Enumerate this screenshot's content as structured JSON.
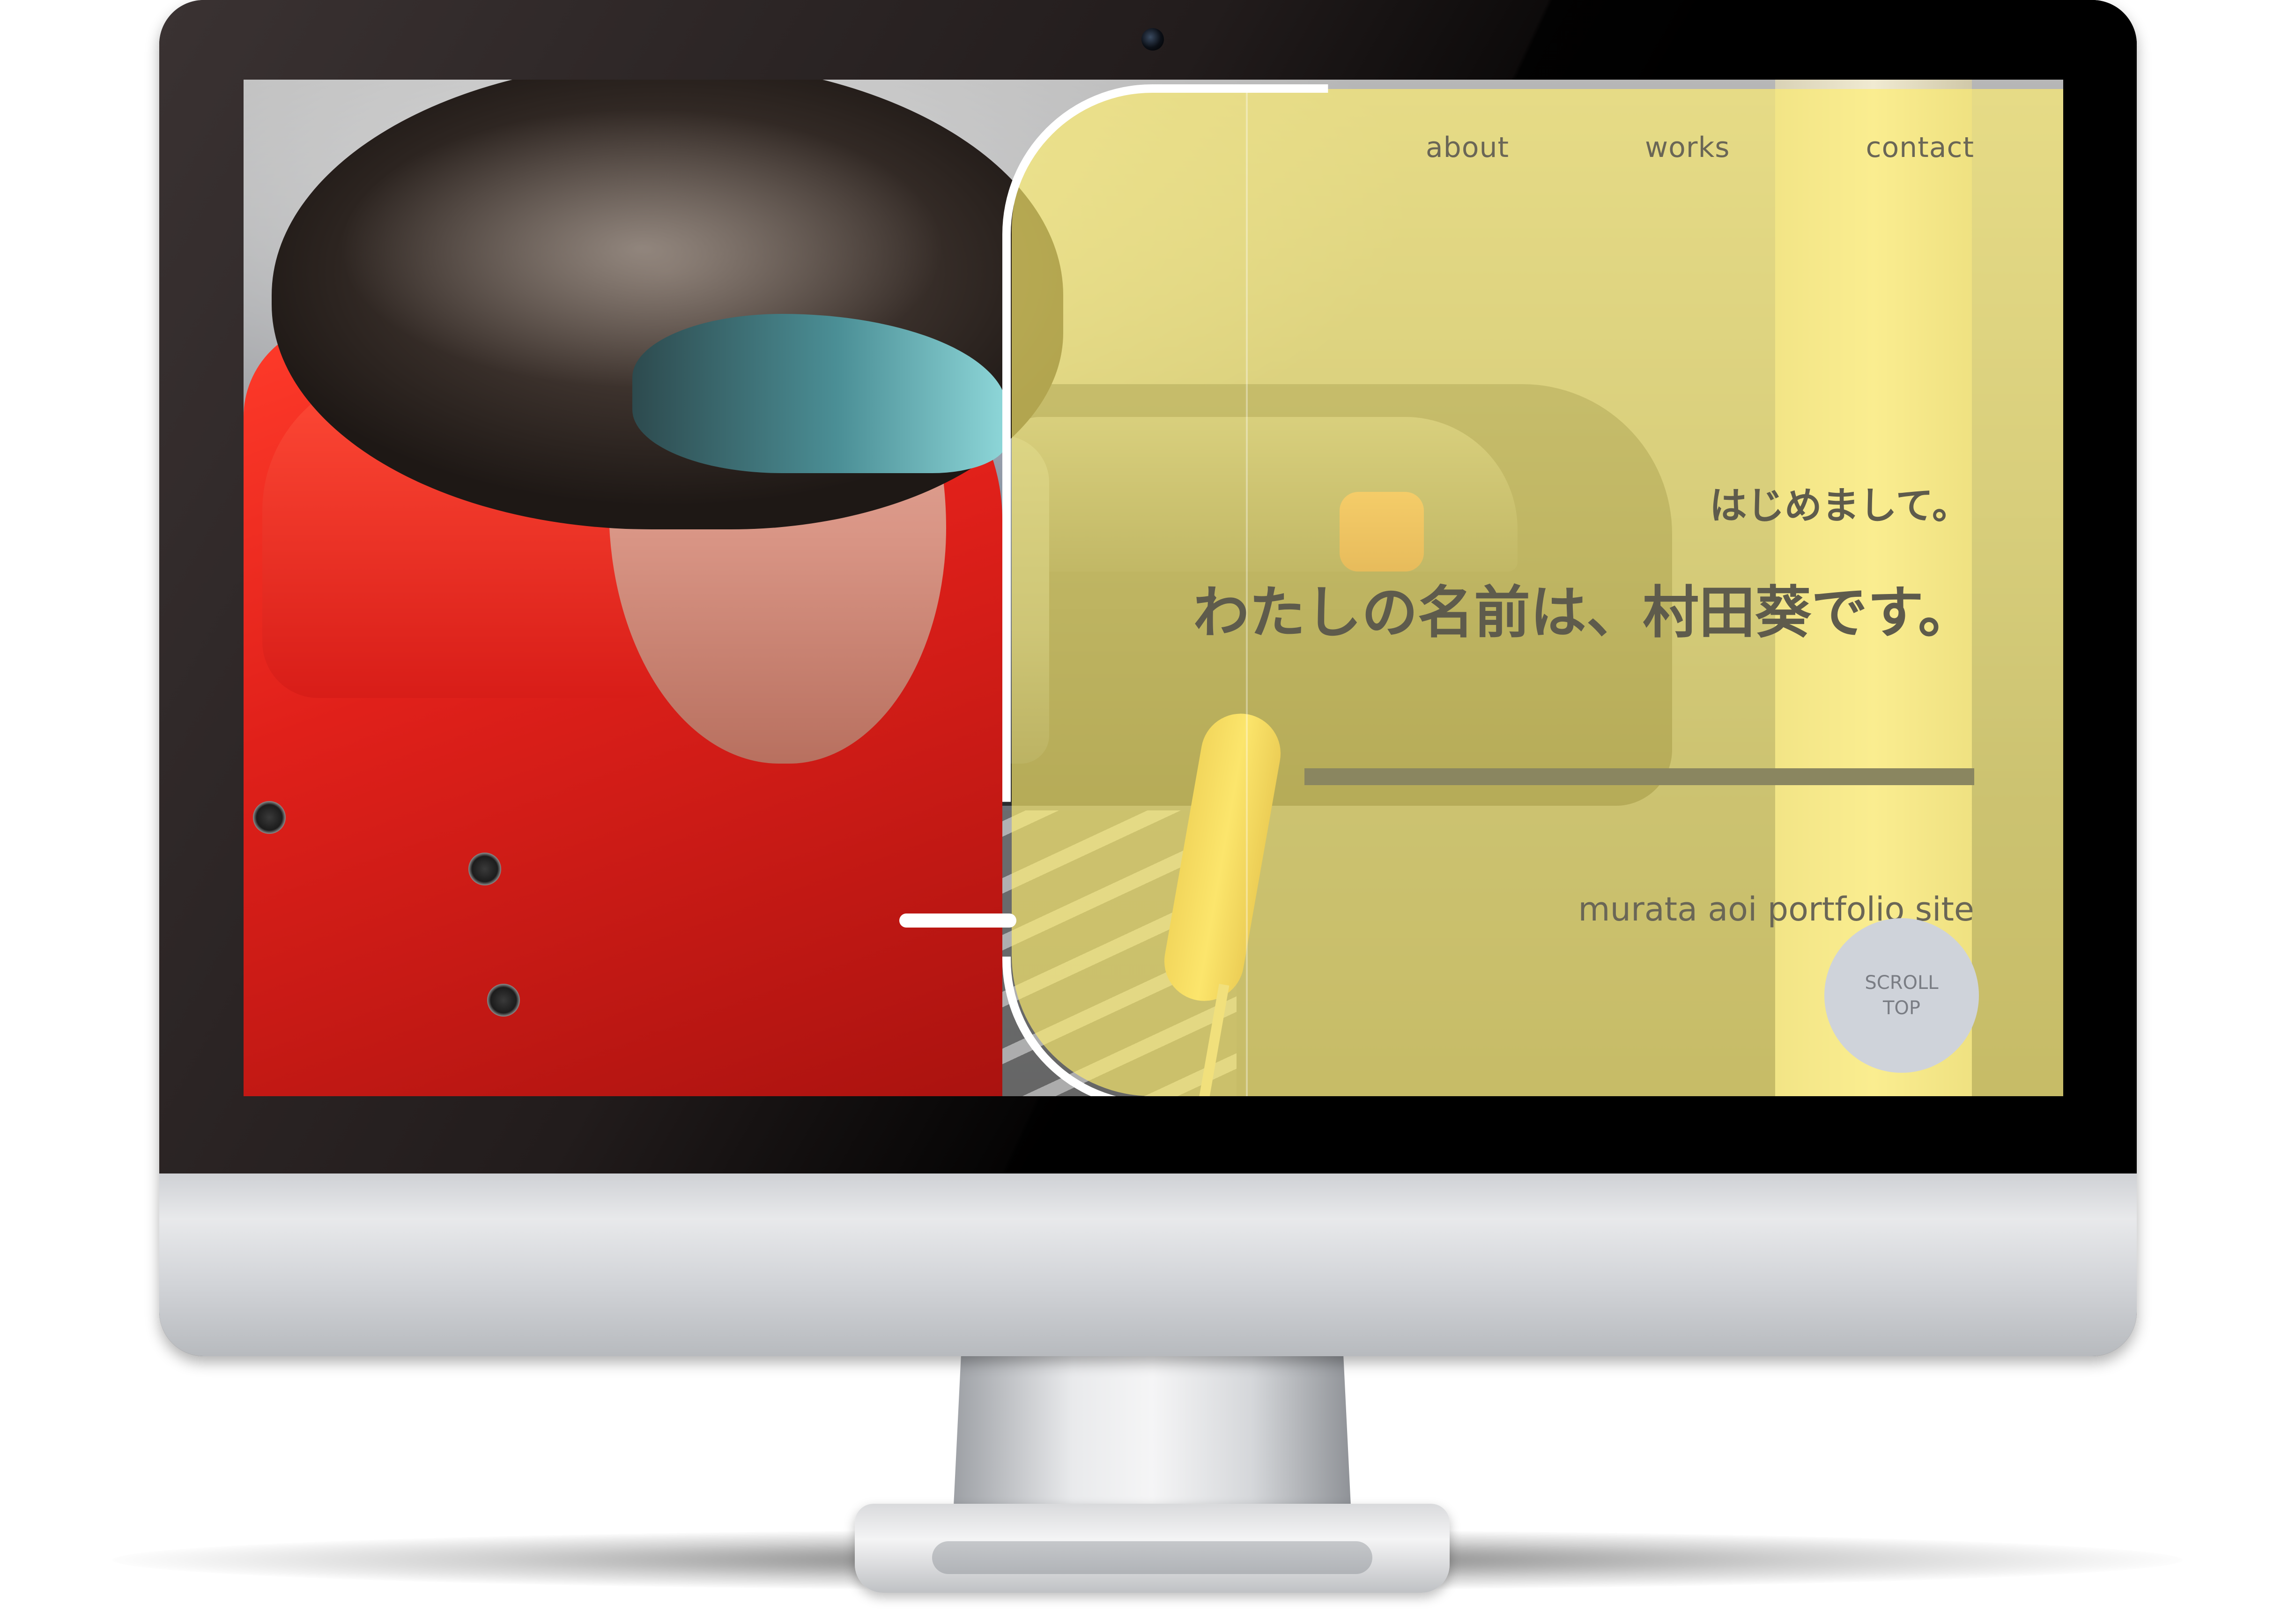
{
  "nav": {
    "items": [
      {
        "label": "about"
      },
      {
        "label": "works"
      },
      {
        "label": "contact"
      }
    ]
  },
  "hero": {
    "greeting_small": "はじめまして。",
    "greeting_big": "わたしの名前は、村田葵です。",
    "site_label": "murata aoi portfolio site"
  },
  "scroll_top": {
    "line1": "SCROLL",
    "line2": "TOP"
  },
  "colors": {
    "overlay": "#FFEF6E",
    "text": "#5E5B4C",
    "scroll_button": "#CFD3DA"
  }
}
